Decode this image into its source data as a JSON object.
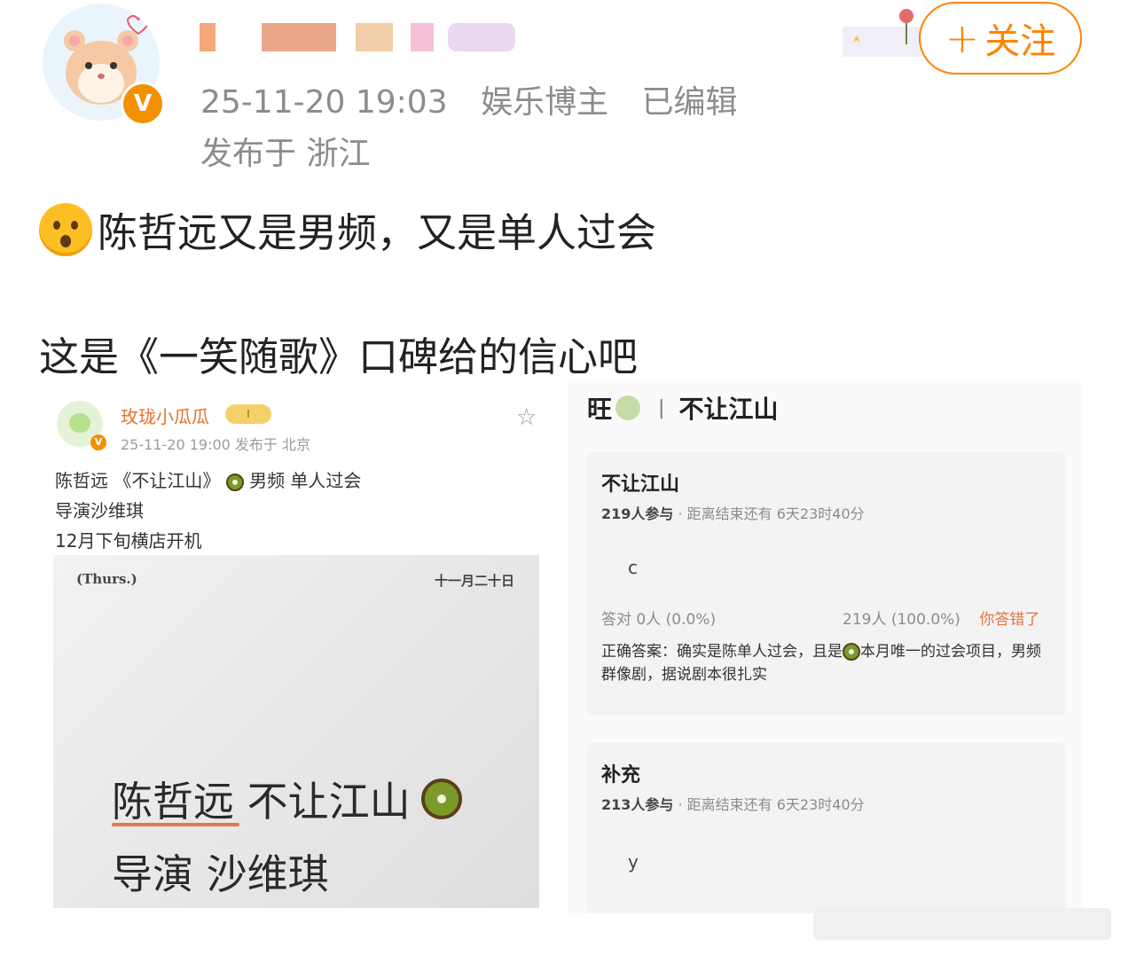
{
  "post": {
    "meta": {
      "timestamp": "25-11-20 19:03",
      "role": "娱乐博主",
      "edited": "已编辑"
    },
    "location": "发布于 浙江",
    "follow_plus": "+",
    "follow_label": "关注",
    "verified_badge": "V",
    "line1": "陈哲远又是男频，又是单人过会",
    "line1_icon": "astonished-face-emoji",
    "line2": "这是《一笑随歌》口碑给的信心吧"
  },
  "left_screenshot": {
    "username": "玫珑小瓜瓜",
    "level_badge": "I",
    "verified_badge": "V",
    "meta": "25-11-20 19:00   发布于 北京",
    "star_icon": "☆",
    "text_line1_a": "陈哲远 《不让江山》",
    "text_line1_b": " 男频 单人过会",
    "text_line2": "导演沙维琪",
    "text_line3": "12月下旬横店开机",
    "poster": {
      "day": "(Thurs.)",
      "date": "十一月二十日",
      "line1": "陈哲远 不让江山",
      "line2": "导演 沙维琪"
    }
  },
  "right_screenshot": {
    "header_left": "旺",
    "header_sep": "|",
    "header_right": "不让江山",
    "poll1": {
      "title": "不让江山",
      "participants": "219人参与",
      "deadline": " · 距离结束还有 6天23时40分",
      "option": "c",
      "correct_stats": "答对  0人 (0.0%)",
      "wrong_stats": "219人 (100.0%)",
      "wrong_label": "你答错了",
      "answer_a": "正确答案：确实是陈单人过会，且是",
      "answer_b": "本月唯一的过会项目，男频群像剧，据说剧本很扎实"
    },
    "poll2": {
      "title": "补充",
      "participants": "213人参与",
      "deadline": " · 距离结束还有 6天23时40分",
      "option": "y"
    }
  },
  "colors": {
    "accent": "#ff8200",
    "meta_gray": "#8c8c8c",
    "verified": "#f29100",
    "wrong": "#e8703a"
  }
}
